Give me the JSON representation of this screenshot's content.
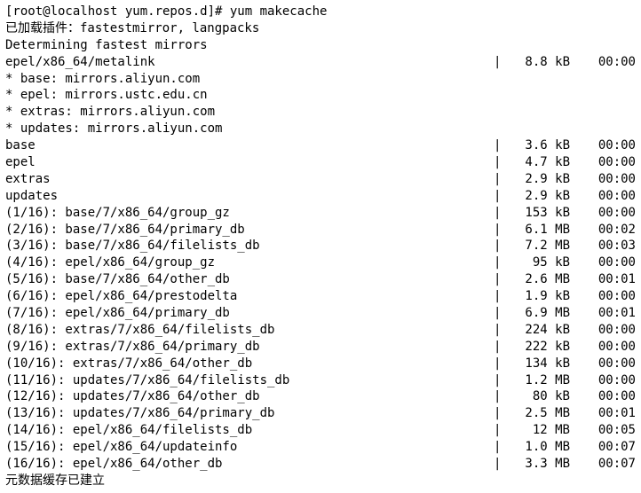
{
  "prompt": "[root@localhost yum.repos.d]# yum makecache",
  "plugins_line": "已加载插件：fastestmirror, langpacks",
  "determining": "Determining fastest mirrors",
  "metalink": {
    "name": "epel/x86_64/metalink",
    "sep": "|",
    "size": "8.8 kB",
    "time": "00:00"
  },
  "mirrors": [
    " * base: mirrors.aliyun.com",
    " * epel: mirrors.ustc.edu.cn",
    " * extras: mirrors.aliyun.com",
    " * updates: mirrors.aliyun.com"
  ],
  "repos": [
    {
      "name": "base",
      "sep": "|",
      "size": "3.6 kB",
      "time": "00:00"
    },
    {
      "name": "epel",
      "sep": "|",
      "size": "4.7 kB",
      "time": "00:00"
    },
    {
      "name": "extras",
      "sep": "|",
      "size": "2.9 kB",
      "time": "00:00"
    },
    {
      "name": "updates",
      "sep": "|",
      "size": "2.9 kB",
      "time": "00:00"
    }
  ],
  "files": [
    {
      "name": "(1/16): base/7/x86_64/group_gz",
      "sep": "|",
      "size": "153 kB",
      "time": "00:00"
    },
    {
      "name": "(2/16): base/7/x86_64/primary_db",
      "sep": "|",
      "size": "6.1 MB",
      "time": "00:02"
    },
    {
      "name": "(3/16): base/7/x86_64/filelists_db",
      "sep": "|",
      "size": "7.2 MB",
      "time": "00:03"
    },
    {
      "name": "(4/16): epel/x86_64/group_gz",
      "sep": "|",
      "size": "95 kB",
      "time": "00:00"
    },
    {
      "name": "(5/16): base/7/x86_64/other_db",
      "sep": "|",
      "size": "2.6 MB",
      "time": "00:01"
    },
    {
      "name": "(6/16): epel/x86_64/prestodelta",
      "sep": "|",
      "size": "1.9 kB",
      "time": "00:00"
    },
    {
      "name": "(7/16): epel/x86_64/primary_db",
      "sep": "|",
      "size": "6.9 MB",
      "time": "00:01"
    },
    {
      "name": "(8/16): extras/7/x86_64/filelists_db",
      "sep": "|",
      "size": "224 kB",
      "time": "00:00"
    },
    {
      "name": "(9/16): extras/7/x86_64/primary_db",
      "sep": "|",
      "size": "222 kB",
      "time": "00:00"
    },
    {
      "name": "(10/16): extras/7/x86_64/other_db",
      "sep": "|",
      "size": "134 kB",
      "time": "00:00"
    },
    {
      "name": "(11/16): updates/7/x86_64/filelists_db",
      "sep": "|",
      "size": "1.2 MB",
      "time": "00:00"
    },
    {
      "name": "(12/16): updates/7/x86_64/other_db",
      "sep": "|",
      "size": "80 kB",
      "time": "00:00"
    },
    {
      "name": "(13/16): updates/7/x86_64/primary_db",
      "sep": "|",
      "size": "2.5 MB",
      "time": "00:01"
    },
    {
      "name": "(14/16): epel/x86_64/filelists_db",
      "sep": "|",
      "size": "12 MB",
      "time": "00:05"
    },
    {
      "name": "(15/16): epel/x86_64/updateinfo",
      "sep": "|",
      "size": "1.0 MB",
      "time": "00:07"
    },
    {
      "name": "(16/16): epel/x86_64/other_db",
      "sep": "|",
      "size": "3.3 MB",
      "time": "00:07"
    }
  ],
  "footer": "元数据缓存已建立"
}
